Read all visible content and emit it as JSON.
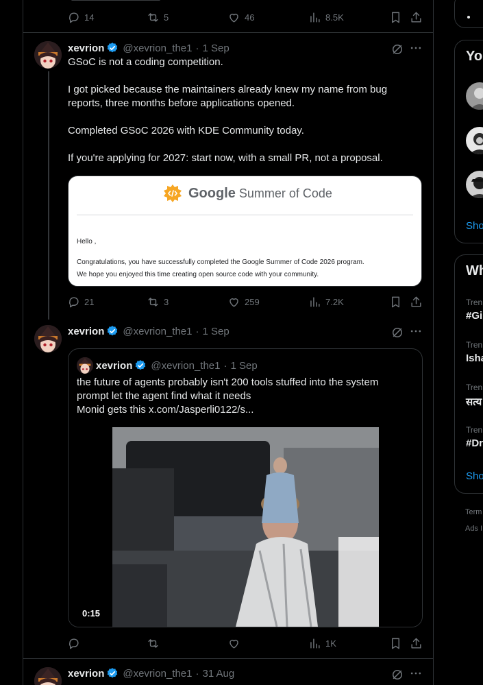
{
  "top_actions": {
    "replies": "14",
    "reposts": "5",
    "likes": "46",
    "views": "8.5K"
  },
  "post1": {
    "name": "xevrion",
    "handle": "@xevrion_the1",
    "dot": "·",
    "date": "1 Sep",
    "lines": [
      "GSoC is not a coding competition.",
      "I got picked because the maintainers already knew my name from bug reports, three months before applications opened.",
      "Completed GSoC 2026 with KDE Community today.",
      "If you're applying for 2027: start now, with a small PR, not a proposal."
    ],
    "email": {
      "logo_google": "Google",
      "logo_rest": "Summer of Code",
      "greeting": "Hello ,",
      "body1": "Congratulations, you have successfully completed the Google Summer of Code 2026 program.",
      "body2": "We hope you enjoyed this time creating open source code with your community."
    },
    "actions": {
      "replies": "21",
      "reposts": "3",
      "likes": "259",
      "views": "7.2K"
    }
  },
  "post2": {
    "name": "xevrion",
    "handle": "@xevrion_the1",
    "dot": "·",
    "date": "1 Sep",
    "quote": {
      "name": "xevrion",
      "handle": "@xevrion_the1",
      "dot": "·",
      "date": "1 Sep",
      "line1": "the future of agents probably isn't 200 tools stuffed into the system",
      "line2": "prompt let the agent find what it needs",
      "line3": "Monid gets this  x.com/Jasperli0122/s...",
      "video_time": "0:15"
    },
    "actions": {
      "replies": "",
      "reposts": "",
      "likes": "",
      "views": "1K"
    }
  },
  "post3": {
    "name": "xevrion",
    "handle": "@xevrion_the1",
    "dot": "·",
    "date": "31 Aug"
  },
  "sidebar": {
    "who_title": "Yo",
    "who_show": "Sho",
    "whats_title": "Wh",
    "trends": [
      {
        "label": "Tren",
        "name": "#Gi"
      },
      {
        "label": "Tren",
        "name": "Isha"
      },
      {
        "label": "Tren",
        "name": "सत्य"
      },
      {
        "label": "Tren",
        "name": "#Dr"
      }
    ],
    "trends_show": "Sho",
    "footer1": "Term",
    "footer2": "Ads I"
  },
  "colors": {
    "accent": "#1d9bf0",
    "border": "#2f3336",
    "muted": "#71767b",
    "text": "#e7e9ea"
  }
}
